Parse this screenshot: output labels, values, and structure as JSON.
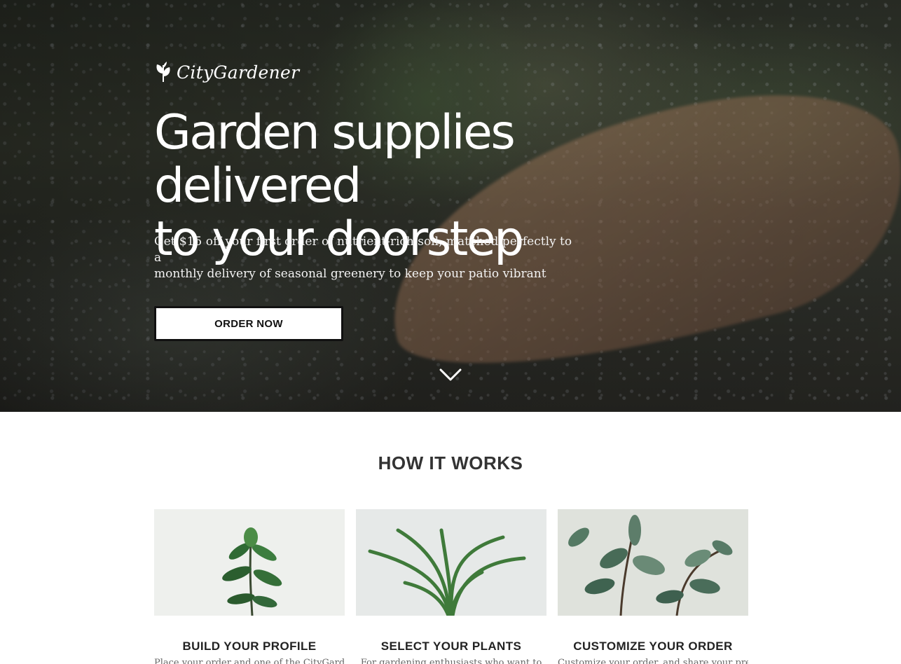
{
  "brand": {
    "name": "CityGardener",
    "logo_icon": "leaf-icon"
  },
  "hero": {
    "title_line1": "Garden supplies delivered",
    "title_line2": "to your doorstep",
    "subtitle_line1": "Get $15 off your first order of nutrient-rich soil, matched perfectly to a",
    "subtitle_line2": "monthly delivery of seasonal greenery to keep your patio vibrant",
    "cta_label": "ORDER NOW",
    "scroll_icon": "chevron-down-icon"
  },
  "how_it_works": {
    "title": "HOW IT WORKS",
    "steps": [
      {
        "title": "BUILD YOUR PROFILE",
        "desc": "Place your order and one of the CityGardeners"
      },
      {
        "title": "SELECT YOUR PLANTS",
        "desc": "For gardening enthusiasts who want to"
      },
      {
        "title": "CUSTOMIZE YOUR ORDER",
        "desc": "Customize your order, and share your preferences"
      }
    ]
  },
  "colors": {
    "hero_overlay": "#2d2f29",
    "text_on_dark": "#ffffff",
    "heading": "#333333",
    "button_bg": "#ffffff",
    "button_border": "#111111"
  }
}
